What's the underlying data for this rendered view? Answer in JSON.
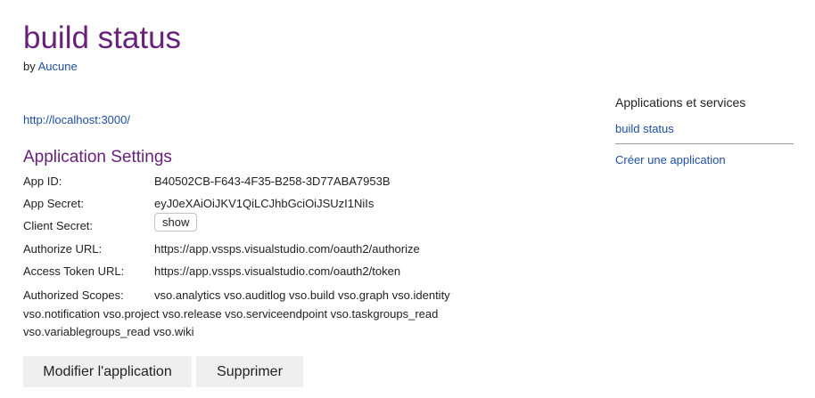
{
  "app": {
    "title": "build status",
    "by_prefix": "by",
    "author": "Aucune",
    "homepage_url": "http://localhost:3000/"
  },
  "settings": {
    "title": "Application Settings",
    "app_id_label": "App ID:",
    "app_id_value": "B40502CB-F643-4F35-B258-3D77ABA7953B",
    "app_secret_label": "App Secret:",
    "app_secret_value": "eyJ0eXAiOiJKV1QiLCJhbGciOiJSUzI1NiIs",
    "client_secret_label": "Client Secret:",
    "client_secret_button": "show",
    "authorize_url_label": "Authorize URL:",
    "authorize_url_value": "https://app.vssps.visualstudio.com/oauth2/authorize",
    "access_token_url_label": "Access Token URL:",
    "access_token_url_value": "https://app.vssps.visualstudio.com/oauth2/token",
    "scopes_label": "Authorized Scopes:",
    "scopes_line1": "vso.analytics vso.auditlog vso.build vso.graph vso.identity",
    "scopes_line2": "vso.notification vso.project vso.release vso.serviceendpoint vso.taskgroups_read",
    "scopes_line3": "vso.variablegroups_read vso.wiki"
  },
  "actions": {
    "modify_label": "Modifier l'application",
    "delete_label": "Supprimer"
  },
  "sidebar": {
    "title": "Applications et services",
    "items": [
      {
        "label": "build status"
      }
    ],
    "create_label": "Créer une application"
  },
  "colors": {
    "accent_purple": "#68217a",
    "link_blue": "#1e4fa5",
    "button_bg": "#efefef"
  }
}
